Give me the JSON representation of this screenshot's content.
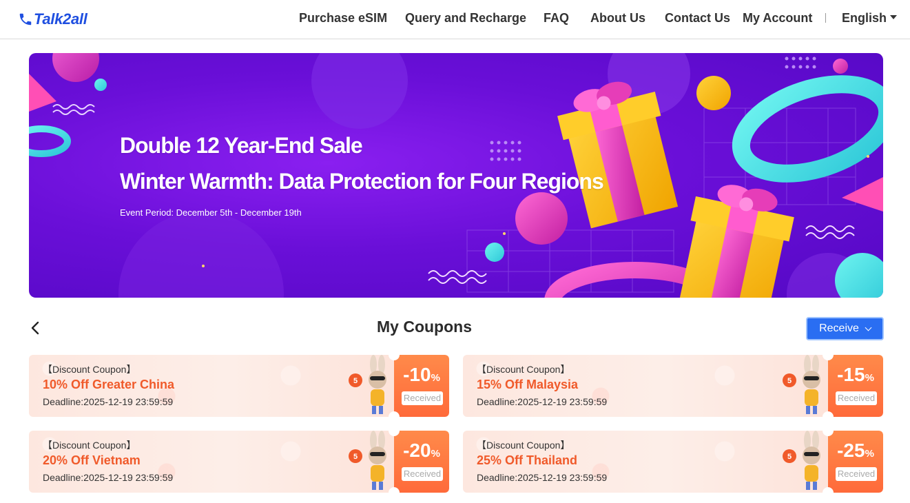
{
  "header": {
    "logo_text": "Talk2all",
    "nav": [
      {
        "label": "Purchase eSIM"
      },
      {
        "label": "Query and Recharge"
      },
      {
        "label": "FAQ"
      },
      {
        "label": "About Us"
      },
      {
        "label": "Contact Us"
      },
      {
        "label": "My Account"
      }
    ],
    "language": "English"
  },
  "banner": {
    "title": "Double 12 Year-End Sale",
    "subtitle": "Winter Warmth: Data Protection for Four Regions",
    "period": "Event Period: December 5th - December 19th"
  },
  "coupons_section": {
    "title": "My Coupons",
    "receive_label": "Receive"
  },
  "coupons": [
    {
      "tag": "【Discount Coupon】",
      "name": "10% Off Greater China",
      "deadline": "Deadline:2025-12-19 23:59:59",
      "discount": "-10",
      "unit": "%",
      "status": "Received",
      "mascot_badge": "5"
    },
    {
      "tag": "【Discount Coupon】",
      "name": "15% Off Malaysia",
      "deadline": "Deadline:2025-12-19 23:59:59",
      "discount": "-15",
      "unit": "%",
      "status": "Received",
      "mascot_badge": "5"
    },
    {
      "tag": "【Discount Coupon】",
      "name": "20% Off Vietnam",
      "deadline": "Deadline:2025-12-19 23:59:59",
      "discount": "-20",
      "unit": "%",
      "status": "Received",
      "mascot_badge": "5"
    },
    {
      "tag": "【Discount Coupon】",
      "name": "25% Off Thailand",
      "deadline": "Deadline:2025-12-19 23:59:59",
      "discount": "-25",
      "unit": "%",
      "status": "Received",
      "mascot_badge": "5"
    }
  ],
  "colors": {
    "brand": "#1f4fe0",
    "accent_orange": "#f05a2a",
    "receive_button": "#2a6ef2",
    "banner_purple": "#6a0fd8"
  }
}
